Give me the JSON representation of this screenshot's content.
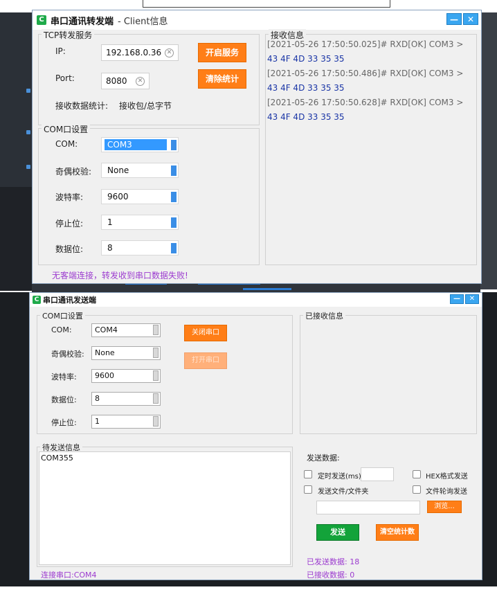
{
  "client_window": {
    "title": "串口通讯转发端",
    "subtitle": "- Client信息",
    "minimize": "—",
    "close": "✕",
    "tcp_group": {
      "title": "TCP转发服务",
      "ip_label": "IP:",
      "ip_value": "192.168.0.36",
      "port_label": "Port:",
      "port_value": "8080",
      "start_button": "开启服务",
      "clear_stats_button": "清除统计",
      "stats_label": "接收数据统计:",
      "stats_value": "接收包/总字节"
    },
    "com_group": {
      "title": "COM口设置",
      "com_label": "COM:",
      "com_value": "COM3",
      "parity_label": "奇偶校验:",
      "parity_value": "None",
      "baud_label": "波特率:",
      "baud_value": "9600",
      "stopbits_label": "停止位:",
      "stopbits_value": "1",
      "databits_label": "数据位:",
      "databits_value": "8"
    },
    "recv_group": {
      "title": "接收信息",
      "lines": [
        {
          "header": "[2021-05-26 17:50:50.025]# RXD[OK] COM3 >",
          "data": "43 4F 4D 33 35 35"
        },
        {
          "header": "[2021-05-26 17:50:50.486]# RXD[OK] COM3 >",
          "data": "43 4F 4D 33 35 35"
        },
        {
          "header": "[2021-05-26 17:50:50.628]# RXD[OK] COM3 >",
          "data": "43 4F 4D 33 35 35"
        }
      ]
    },
    "status": "无客端连接，转发收到串口数据失败!"
  },
  "sender_window": {
    "title": "串口通讯发送端",
    "minimize": "—",
    "close": "✕",
    "com_group": {
      "title": "COM口设置",
      "com_label": "COM:",
      "com_value": "COM4",
      "parity_label": "奇偶校验:",
      "parity_value": "None",
      "baud_label": "波特率:",
      "baud_value": "9600",
      "databits_label": "数据位:",
      "databits_value": "8",
      "stopbits_label": "停止位:",
      "stopbits_value": "1",
      "close_port_button": "关闭串口",
      "open_port_button": "打开串口"
    },
    "received_group": {
      "title": "已接收信息"
    },
    "pending_group": {
      "title": "待发送信息",
      "text": "COM355"
    },
    "send_data": {
      "title": "发送数据:",
      "timed_send_label": "定时发送(ms)",
      "timed_send_value": "",
      "hex_send_label": "HEX格式发送",
      "file_send_label": "发送文件/文件夹",
      "file_poll_label": "文件轮询发送",
      "file_path_value": "",
      "browse_button": "浏览...",
      "send_button": "发送",
      "clear_count_button": "清空统计数"
    },
    "sent_count": "已发送数据: 18",
    "recv_count": "已接收数据: 0",
    "status": "连接串口:COM4"
  },
  "colors": {
    "accent_orange": "#ff7e17",
    "send_green": "#13a33a",
    "status_purple": "#9c3bcf",
    "log_data_blue": "#1a35a6",
    "titlebar_button_blue": "#3aa6f0"
  }
}
